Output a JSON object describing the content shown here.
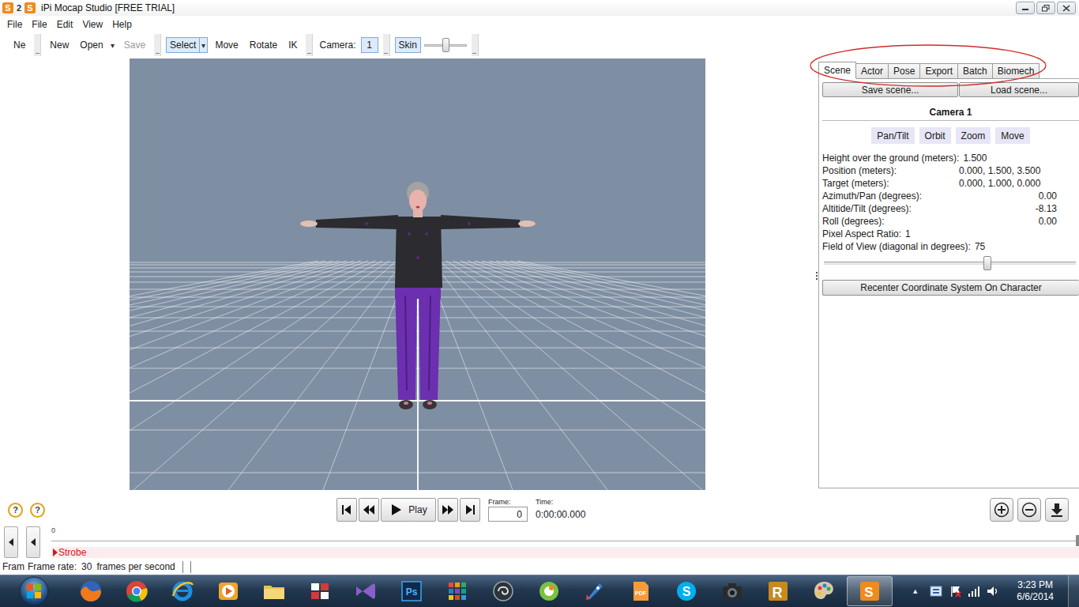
{
  "window": {
    "title": "iPi Mocap Studio [FREE TRIAL]",
    "icons": [
      {
        "text": "S",
        "kind": "badge"
      },
      {
        "text": "2",
        "kind": "plain"
      },
      {
        "text": "S",
        "kind": "badge"
      }
    ]
  },
  "menu": [
    "File",
    "File",
    "Edit",
    "View",
    "Help"
  ],
  "toolbar": [
    {
      "items": [
        {
          "kind": "button",
          "label": "Ne",
          "selected": false,
          "disabled": false
        }
      ]
    },
    {
      "items": [
        {
          "kind": "button",
          "label": "New",
          "selected": false,
          "disabled": false
        },
        {
          "kind": "button",
          "label": "Open",
          "selected": false,
          "disabled": false
        },
        {
          "kind": "arrow",
          "label": "▾",
          "selected": false,
          "disabled": false
        },
        {
          "kind": "button",
          "label": "Save",
          "selected": false,
          "disabled": true
        }
      ]
    },
    {
      "items": [
        {
          "kind": "button",
          "label": "Select",
          "selected": true,
          "disabled": false
        },
        {
          "kind": "arrow",
          "label": "▾",
          "selected": true,
          "disabled": false
        },
        {
          "kind": "button",
          "label": "Move",
          "selected": false,
          "disabled": false
        },
        {
          "kind": "button",
          "label": "Rotate",
          "selected": false,
          "disabled": false
        },
        {
          "kind": "button",
          "label": "IK",
          "selected": false,
          "disabled": false
        }
      ]
    },
    {
      "items": [
        {
          "kind": "label",
          "label": "Camera:",
          "selected": false,
          "disabled": false
        },
        {
          "kind": "field",
          "label": "1",
          "selected": true,
          "disabled": false
        }
      ]
    },
    {
      "items": [
        {
          "kind": "button",
          "label": "Skin",
          "selected": true,
          "disabled": false
        },
        {
          "kind": "slider",
          "level": 0.5,
          "selected": false,
          "disabled": false
        }
      ]
    }
  ],
  "panel": {
    "circled": true,
    "tabs": [
      {
        "label": "Scene",
        "selected": true
      },
      {
        "label": "Actor",
        "selected": false
      },
      {
        "label": "Pose",
        "selected": false
      },
      {
        "label": "Export",
        "selected": false
      },
      {
        "label": "Batch",
        "selected": false
      },
      {
        "label": "Biomech",
        "selected": false
      }
    ],
    "buttons": [
      "Save scene...",
      "Load scene..."
    ],
    "heading": "Camera 1",
    "modes": [
      "Pan/Tilt",
      "Orbit",
      "Zoom",
      "Move"
    ],
    "properties": [
      {
        "label": "Height over the ground (meters):",
        "value": "1.500",
        "kind": "inline"
      },
      {
        "label": "Position (meters):",
        "value": "0.000, 1.500, 3.500",
        "kind": "column"
      },
      {
        "label": "Target (meters):",
        "value": "0.000, 1.000, 0.000",
        "kind": "column"
      },
      {
        "label": "Azimuth/Pan (degrees):",
        "value": "0.00",
        "kind": "right"
      },
      {
        "label": "Altitide/Tilt (degrees):",
        "value": "-8.13",
        "kind": "right"
      },
      {
        "label": "Roll (degrees):",
        "value": "0.00",
        "kind": "right"
      },
      {
        "label": "Pixel Aspect Ratio:",
        "value": "1",
        "kind": "inline"
      },
      {
        "label": "Field of View (diagonal in degrees):",
        "value": "75",
        "kind": "inline"
      }
    ],
    "fov_slider": {
      "level": 0.65
    },
    "recenter": "Recenter Coordinate System On Character"
  },
  "playback": {
    "help": [
      "?",
      "?"
    ],
    "play": "Play",
    "frame": {
      "label": "Frame:",
      "value": "0"
    },
    "time": {
      "label": "Time:",
      "value": "0:00:00.000"
    }
  },
  "timeline": {
    "start": "0",
    "strobe": "Strobe"
  },
  "status_bar": {
    "cut": "Fram",
    "label": "Frame rate:",
    "value": "30",
    "unit": "frames per second"
  },
  "taskbar": {
    "apps": [
      {
        "kind": "firefox",
        "active": false
      },
      {
        "kind": "chrome",
        "active": false
      },
      {
        "kind": "ie",
        "active": false
      },
      {
        "kind": "media",
        "active": false
      },
      {
        "kind": "folder",
        "active": false
      },
      {
        "kind": "tiles",
        "active": false
      },
      {
        "kind": "vs",
        "active": false
      },
      {
        "kind": "ps",
        "text": "Ps",
        "active": false
      },
      {
        "kind": "grid",
        "active": false
      },
      {
        "kind": "max",
        "active": false
      },
      {
        "kind": "green",
        "active": false
      },
      {
        "kind": "rocket",
        "active": false
      },
      {
        "kind": "pdf",
        "text": "PDF",
        "active": false
      },
      {
        "kind": "skype",
        "text": "S",
        "active": false
      },
      {
        "kind": "camera",
        "active": false
      },
      {
        "kind": "r",
        "text": "R",
        "active": false
      },
      {
        "kind": "paint",
        "active": false
      },
      {
        "kind": "s",
        "text": "S",
        "active": true
      }
    ],
    "tray_arrow": "▲",
    "clock": {
      "time": "3:23 PM",
      "date": "6/6/2014"
    }
  }
}
